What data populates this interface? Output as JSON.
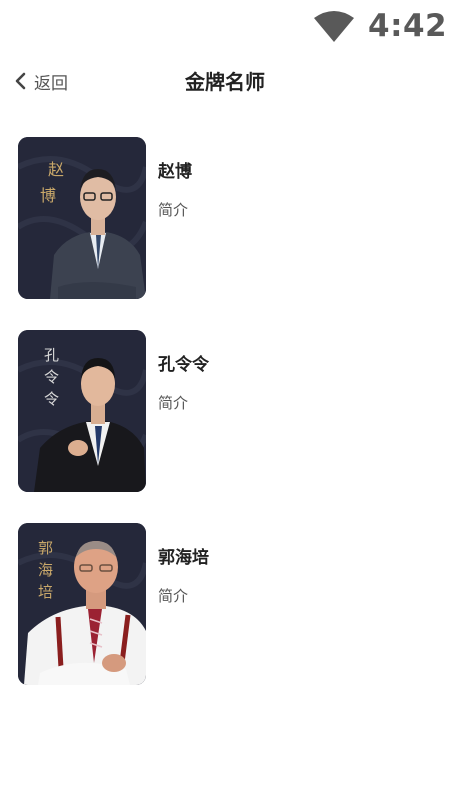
{
  "status_bar": {
    "time": "4:42",
    "wifi_icon": "wifi-icon"
  },
  "header": {
    "back_label": "返回",
    "back_icon": "chevron-left-icon",
    "title": "金牌名师"
  },
  "teachers": [
    {
      "name": "赵博",
      "intro": "简介",
      "calligraphy": [
        "赵",
        "博"
      ]
    },
    {
      "name": "孔令令",
      "intro": "简介",
      "calligraphy": [
        "孔",
        "令",
        "令"
      ]
    },
    {
      "name": "郭海培",
      "intro": "简介",
      "calligraphy": [
        "郭",
        "海",
        "培"
      ]
    }
  ],
  "colors": {
    "photo_background": "#25283a",
    "calligraphy": "#c9a86a",
    "status_text": "#595959"
  }
}
